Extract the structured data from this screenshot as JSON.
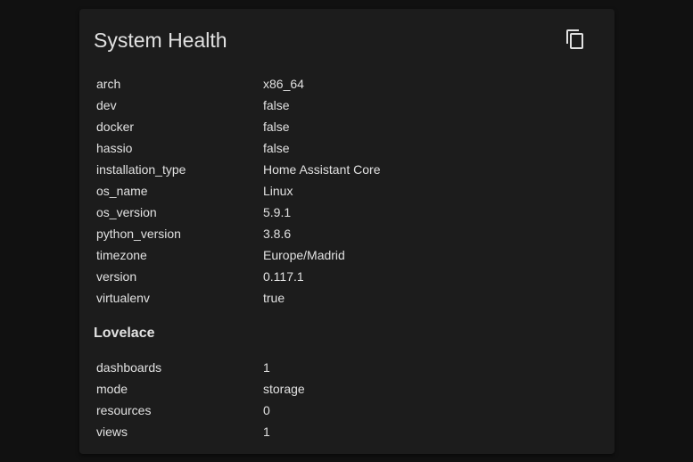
{
  "card": {
    "title": "System Health",
    "copy_icon": "content-copy-icon"
  },
  "system": [
    {
      "key": "arch",
      "value": "x86_64"
    },
    {
      "key": "dev",
      "value": "false"
    },
    {
      "key": "docker",
      "value": "false"
    },
    {
      "key": "hassio",
      "value": "false"
    },
    {
      "key": "installation_type",
      "value": "Home Assistant Core"
    },
    {
      "key": "os_name",
      "value": "Linux"
    },
    {
      "key": "os_version",
      "value": "5.9.1"
    },
    {
      "key": "python_version",
      "value": "3.8.6"
    },
    {
      "key": "timezone",
      "value": "Europe/Madrid"
    },
    {
      "key": "version",
      "value": "0.117.1"
    },
    {
      "key": "virtualenv",
      "value": "true"
    }
  ],
  "lovelace": {
    "title": "Lovelace",
    "rows": [
      {
        "key": "dashboards",
        "value": "1"
      },
      {
        "key": "mode",
        "value": "storage"
      },
      {
        "key": "resources",
        "value": "0"
      },
      {
        "key": "views",
        "value": "1"
      }
    ]
  },
  "colors": {
    "background": "#111111",
    "card": "#1c1c1c",
    "text": "#e1e1e1"
  }
}
